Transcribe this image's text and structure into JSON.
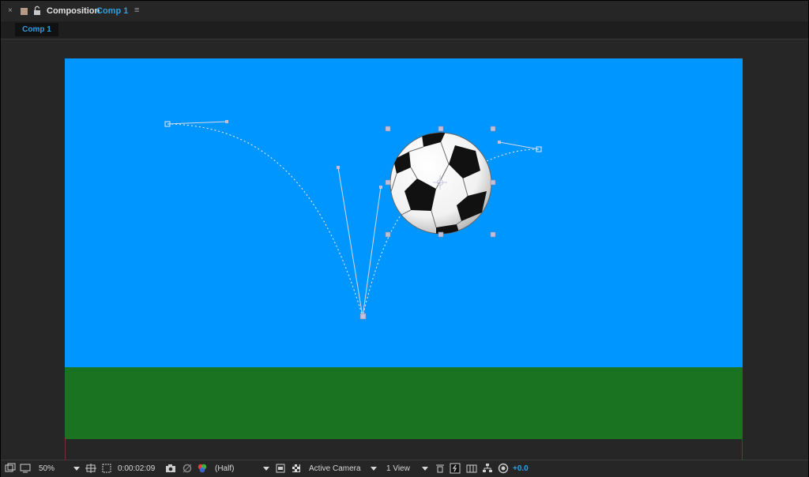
{
  "panel": {
    "close_glyph": "×",
    "title": "Composition",
    "comp_name": "Comp 1",
    "menu_glyph": "≡"
  },
  "tab": {
    "label": "Comp 1"
  },
  "colors": {
    "sky": "#0096ff",
    "grass": "#1a7321",
    "accent": "#2e9fe0",
    "panel_bg": "#262626"
  },
  "toolbar": {
    "magnification": "50%",
    "timecode": "0:00:02:09",
    "resolution": "(Half)",
    "camera": "Active Camera",
    "view_layout": "1 View",
    "exposure": "+0.0",
    "icons": [
      "always-preview-icon",
      "monitor-icon",
      "grid-guides-icon",
      "mask-visibility-icon",
      "region-of-interest-icon",
      "snapshot-icon",
      "show-snapshot-icon",
      "color-channel-icon",
      "fast-previews-icon",
      "transparency-grid-icon",
      "3d-draft-icon",
      "flowchart-icon",
      "reset-exposure-icon"
    ]
  }
}
